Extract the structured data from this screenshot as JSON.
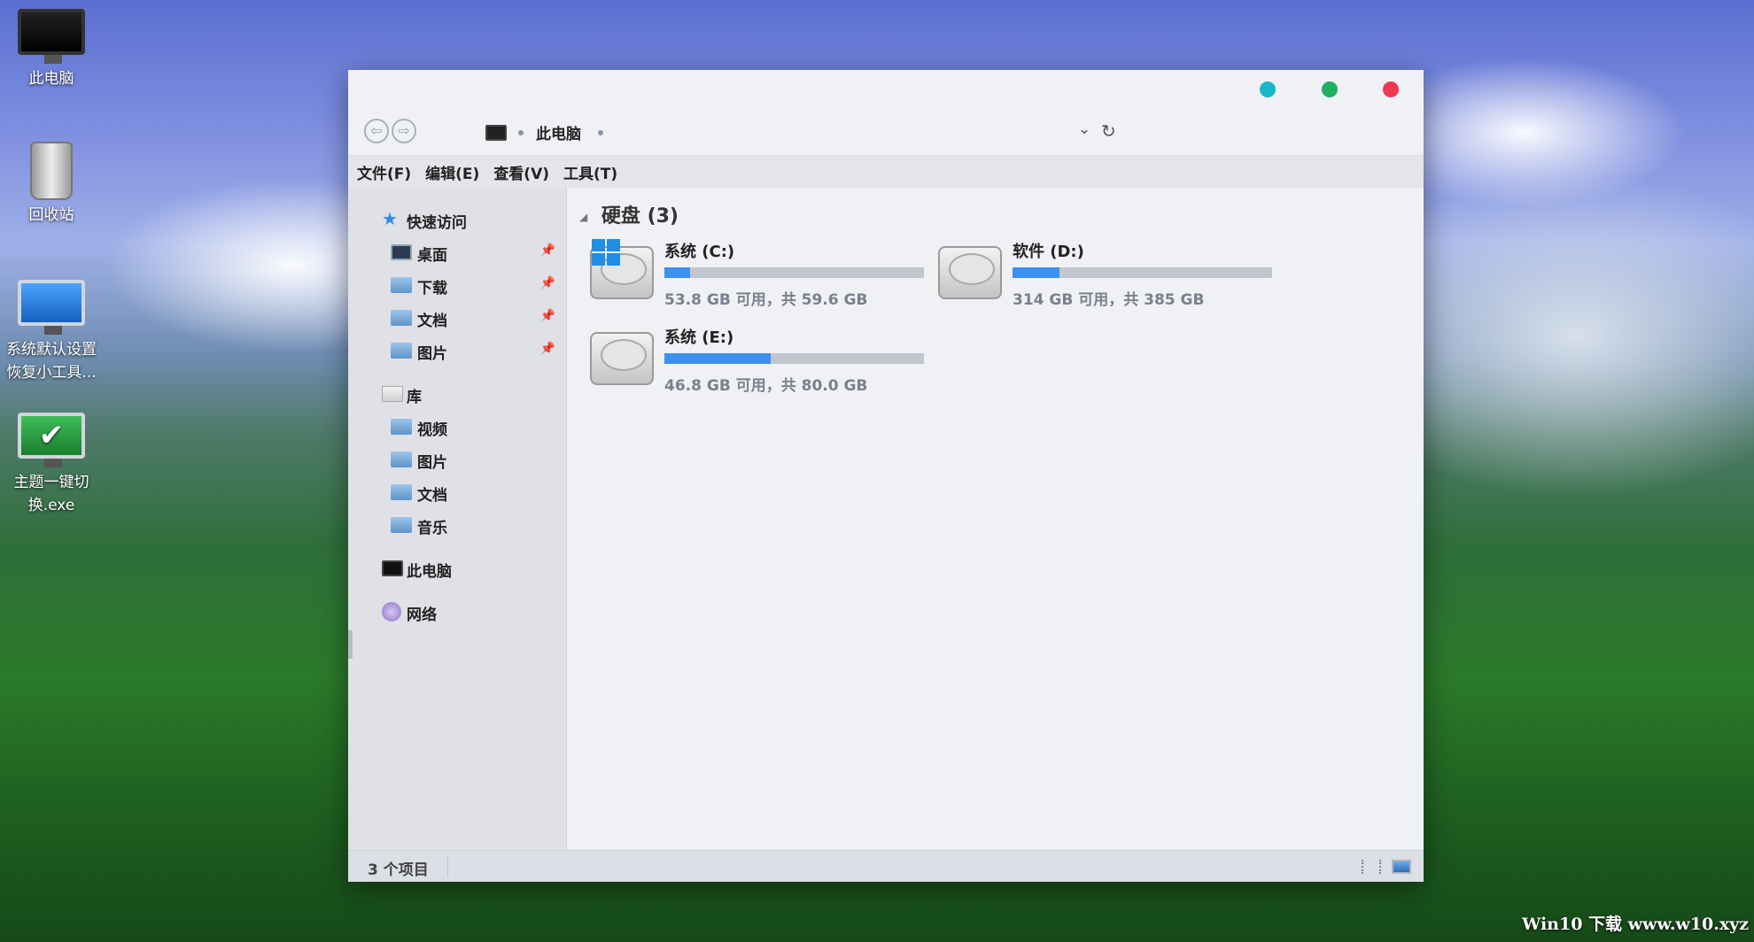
{
  "desktop": {
    "icons": [
      {
        "label": "此电脑",
        "icon": "computer-icon"
      },
      {
        "label": "回收站",
        "icon": "recycle-bin-icon"
      },
      {
        "label": "系统默认设置恢复小工具...",
        "icon": "monitor-icon"
      },
      {
        "label": "主题一键切换.exe",
        "icon": "check-monitor-icon"
      }
    ],
    "watermark": "Win10 下载 www.w10.xyz"
  },
  "window": {
    "title_dots": {
      "minimize": "#19b5c8",
      "maximize": "#1fb063",
      "close": "#ea3a4f"
    },
    "address": {
      "location": "此电脑"
    },
    "menu": [
      {
        "label": "文件(F)"
      },
      {
        "label": "编辑(E)"
      },
      {
        "label": "查看(V)"
      },
      {
        "label": "工具(T)"
      }
    ],
    "sidebar": {
      "quick_access": "快速访问",
      "quick_items": [
        {
          "label": "桌面"
        },
        {
          "label": "下载"
        },
        {
          "label": "文档"
        },
        {
          "label": "图片"
        }
      ],
      "library": "库",
      "library_items": [
        {
          "label": "视频"
        },
        {
          "label": "图片"
        },
        {
          "label": "文档"
        },
        {
          "label": "音乐"
        }
      ],
      "this_pc": "此电脑",
      "network": "网络"
    },
    "content": {
      "group_title": "硬盘 (3)",
      "drives": [
        {
          "name": "系统 (C:)",
          "info": "53.8 GB 可用，共 59.6 GB",
          "used_fraction": 0.1,
          "has_windows_logo": true
        },
        {
          "name": "软件 (D:)",
          "info": "314 GB 可用，共 385 GB",
          "used_fraction": 0.18
        },
        {
          "name": "系统 (E:)",
          "info": "46.8 GB 可用，共 80.0 GB",
          "used_fraction": 0.41
        }
      ]
    },
    "status": {
      "item_count": "3 个项目"
    }
  }
}
